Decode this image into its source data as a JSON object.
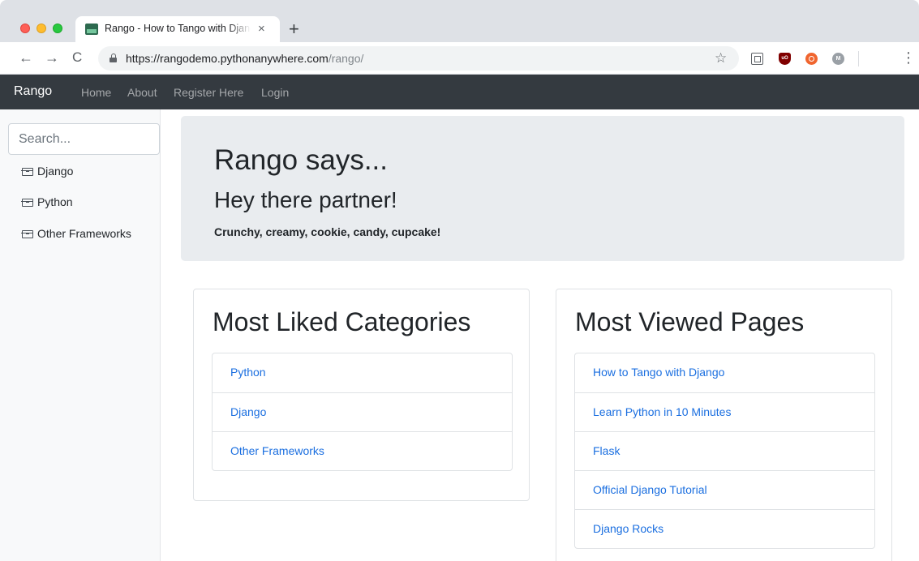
{
  "browser": {
    "tab_title": "Rango - How to Tango with Django",
    "tab_close": "×",
    "new_tab": "+",
    "url_domain": "https://rangodemo.pythonanywhere.com",
    "url_path": "/rango/",
    "nav": {
      "back": "←",
      "forward": "→",
      "reload": "C"
    },
    "star": "☆",
    "menu": "⋮",
    "ext_ublock_text": "uO",
    "ext_grey_text": "M"
  },
  "navbar": {
    "brand": "Rango",
    "links": [
      "Home",
      "About",
      "Register Here",
      "Login"
    ]
  },
  "sidebar": {
    "search_placeholder": "Search...",
    "items": [
      {
        "label": "Django",
        "icon": "archive-icon"
      },
      {
        "label": "Python",
        "icon": "archive-icon"
      },
      {
        "label": "Other Frameworks",
        "icon": "archive-icon"
      }
    ]
  },
  "jumbotron": {
    "title": "Rango says...",
    "subtitle": "Hey there partner!",
    "lead": "Crunchy, creamy, cookie, candy, cupcake!"
  },
  "liked": {
    "title": "Most Liked Categories",
    "items": [
      "Python",
      "Django",
      "Other Frameworks"
    ]
  },
  "viewed": {
    "title": "Most Viewed Pages",
    "items": [
      "How to Tango with Django",
      "Learn Python in 10 Minutes",
      "Flask",
      "Official Django Tutorial",
      "Django Rocks"
    ]
  },
  "colors": {
    "navbar_bg": "#343a40",
    "link": "#1b6fe0",
    "jumbotron_bg": "#e9ecef",
    "sidebar_bg": "#f8f9fa"
  }
}
